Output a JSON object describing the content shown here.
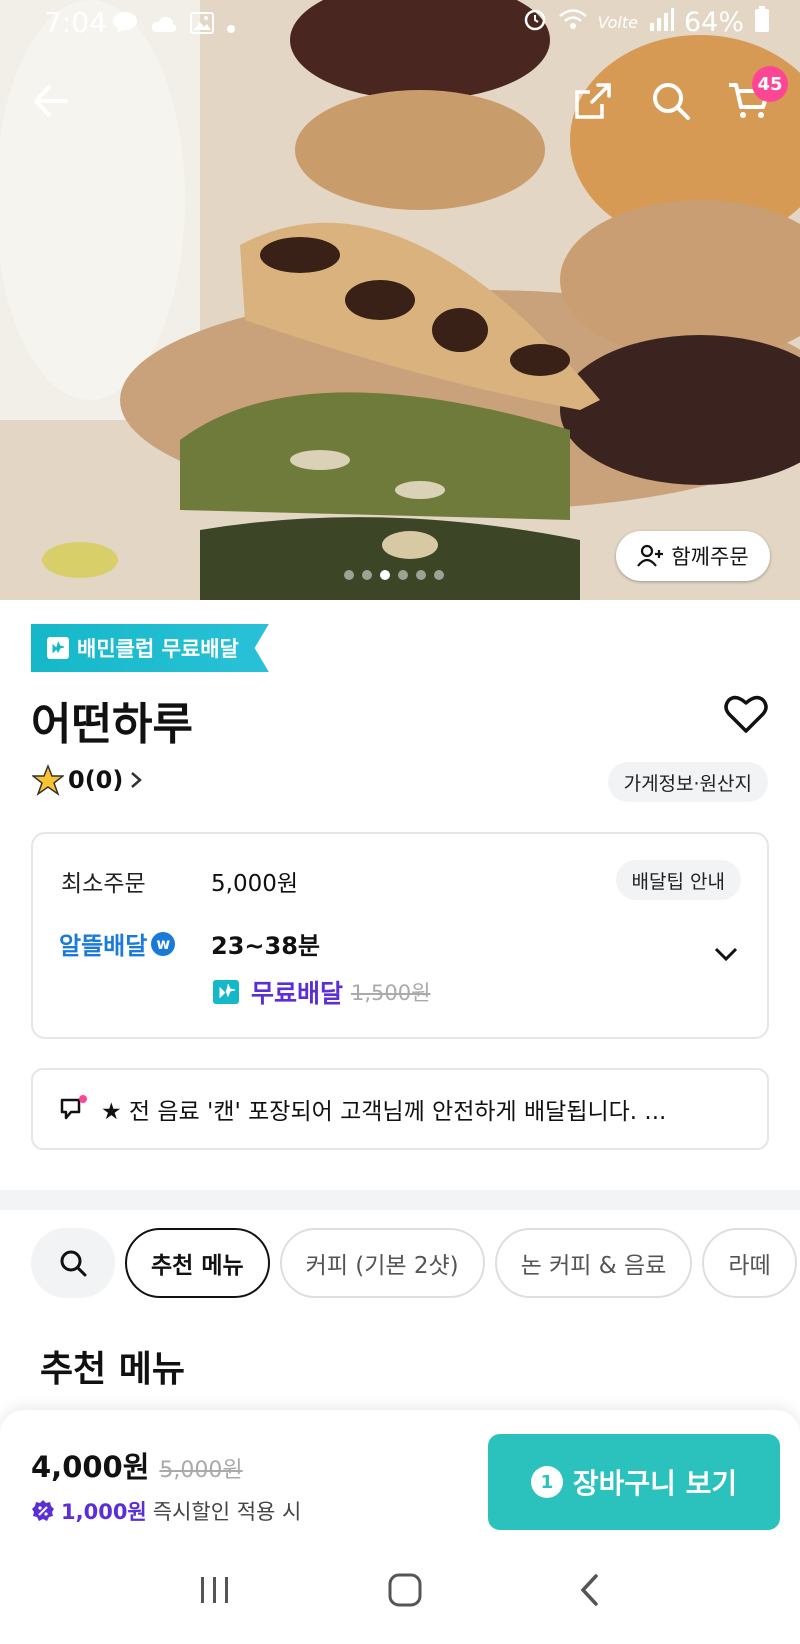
{
  "status_bar": {
    "time": "7:04",
    "battery": "64%",
    "network": "Volte"
  },
  "hero": {
    "together_order_label": "함께주문",
    "cart_count": "45",
    "page_indicator": {
      "count": 6,
      "active_index": 2
    }
  },
  "store": {
    "club_badge": "배민클럽 무료배달",
    "name": "어떤하루",
    "rating": "0(0)",
    "info_chip": "가게정보·원산지"
  },
  "delivery": {
    "min_order_label": "최소주문",
    "min_order_value": "5,000원",
    "tip_chip": "배달팁 안내",
    "service_name": "알뜰배달",
    "service_badge": "w",
    "time_range": "23~38분",
    "free_label": "무료배달",
    "original_fee": "1,500원"
  },
  "notice": {
    "text": "★ 전 음료 '캔' 포장되어 고객님께 안전하게 배달됩니다. ..."
  },
  "categories": [
    "추천 메뉴",
    "커피 (기본 2샷)",
    "논 커피 & 음료",
    "라떼"
  ],
  "section_title": "추천 메뉴",
  "bottom_bar": {
    "price": "4,000원",
    "original_price": "5,000원",
    "discount_amount": "1,000원",
    "discount_text": "즉시할인 적용 시",
    "cart_button_count": "1",
    "cart_button_label": "장바구니 보기"
  },
  "colors": {
    "accent_teal": "#2bc1bc",
    "free_delivery_purple": "#5b2ed6",
    "badge_pink": "#ff4694",
    "club_cyan": "#14b8c8"
  }
}
